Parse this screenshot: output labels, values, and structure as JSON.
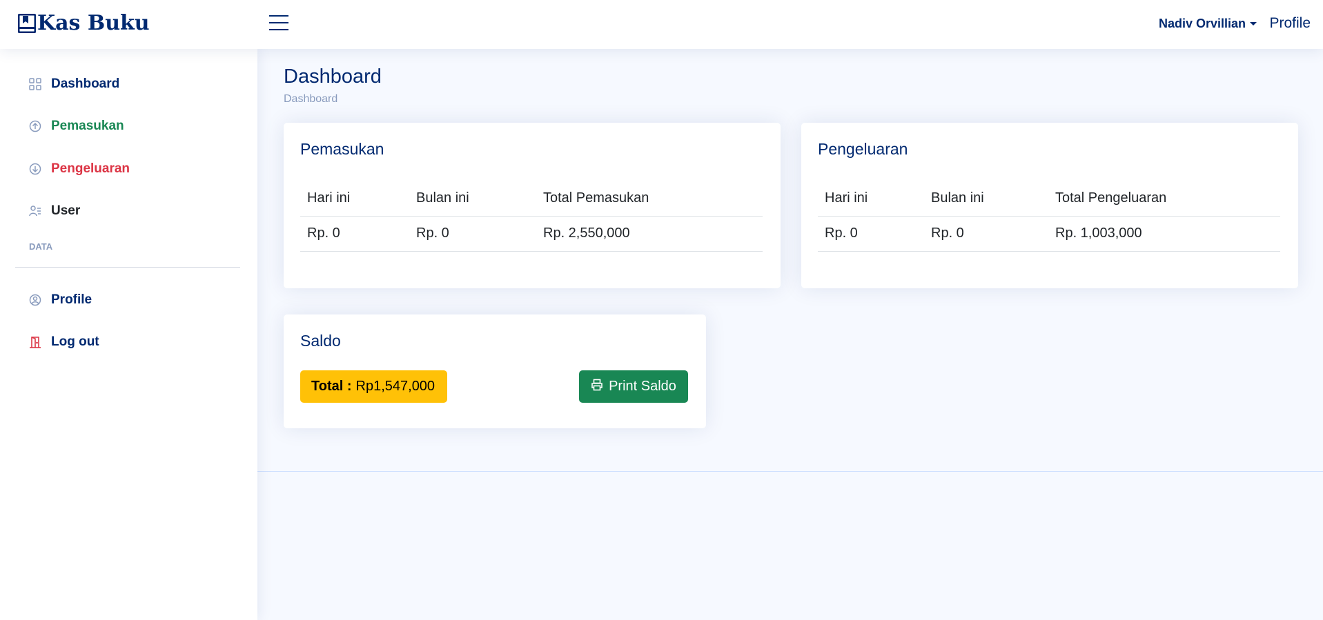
{
  "header": {
    "app_title": "Kas Buku",
    "user_name": "Nadiv Orvillian",
    "profile_link": "Profile"
  },
  "sidebar": {
    "items": [
      {
        "label": "Dashboard",
        "icon": "grid-icon",
        "color": "#012970"
      },
      {
        "label": "Pemasukan",
        "icon": "arrow-up-circle-icon",
        "color": "#198754"
      },
      {
        "label": "Pengeluaran",
        "icon": "arrow-down-circle-icon",
        "color": "#dc3545"
      },
      {
        "label": "User",
        "icon": "person-lines-icon",
        "color": "#012970"
      }
    ],
    "heading": "DATA",
    "bottom_items": [
      {
        "label": "Profile",
        "icon": "person-circle-icon",
        "color": "#012970"
      },
      {
        "label": "Log out",
        "icon": "door-open-icon",
        "color": "#012970"
      }
    ]
  },
  "main": {
    "page_title": "Dashboard",
    "breadcrumb": "Dashboard",
    "pemasukan": {
      "title": "Pemasukan",
      "headers": [
        "Hari ini",
        "Bulan ini",
        "Total Pemasukan"
      ],
      "values": [
        "Rp. 0",
        "Rp. 0",
        "Rp. 2,550,000"
      ]
    },
    "pengeluaran": {
      "title": "Pengeluaran",
      "headers": [
        "Hari ini",
        "Bulan ini",
        "Total Pengeluaran"
      ],
      "values": [
        "Rp. 0",
        "Rp. 0",
        "Rp. 1,003,000"
      ]
    },
    "saldo": {
      "title": "Saldo",
      "total_label": "Total :",
      "total_value": "Rp1,547,000",
      "print_label": "Print Saldo"
    }
  },
  "colors": {
    "primary": "#012970",
    "success": "#198754",
    "danger": "#dc3545",
    "warning": "#ffc107",
    "muted": "#899bbd"
  }
}
